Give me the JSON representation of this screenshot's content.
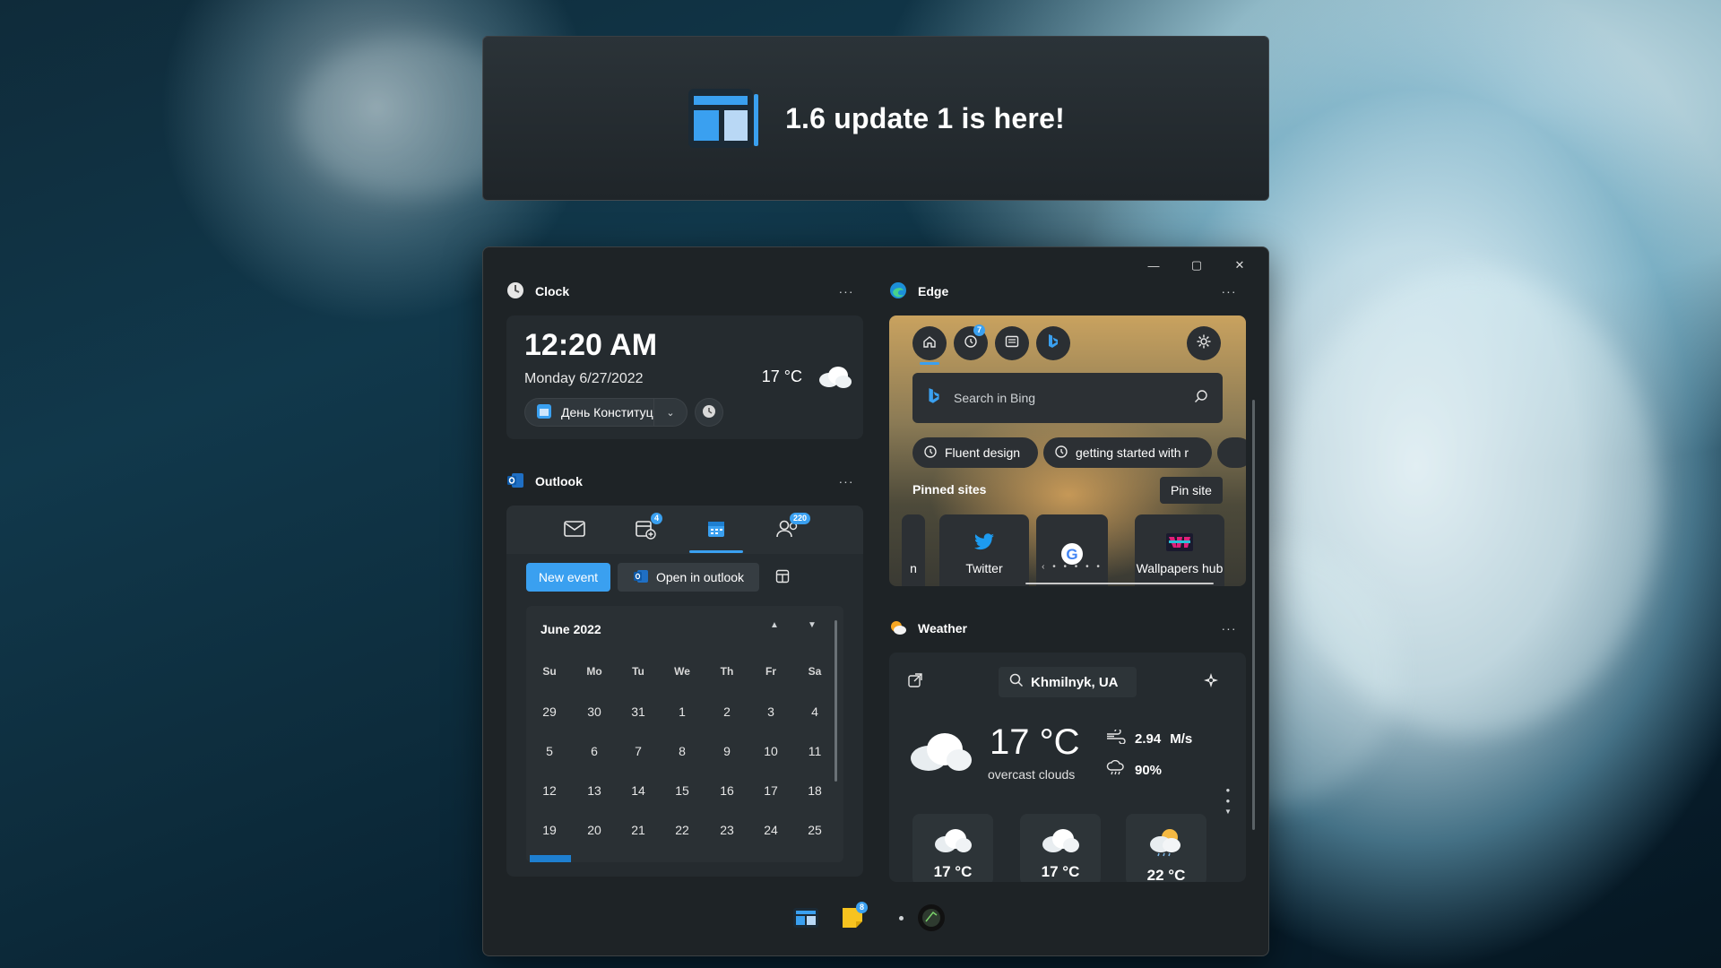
{
  "banner": {
    "title": "1.6 update 1 is here!"
  },
  "window_controls": {
    "minimize": "—",
    "maximize": "▢",
    "close": "✕"
  },
  "clock": {
    "header": "Clock",
    "time": "12:20 AM",
    "date": "Monday 6/27/2022",
    "temperature": "17 °C",
    "holiday": "День Конституц"
  },
  "outlook": {
    "header": "Outlook",
    "calendar_badge": "4",
    "people_badge": "220",
    "new_event": "New event",
    "open_in_outlook": "Open in outlook",
    "month": "June 2022",
    "days_of_week": [
      "Su",
      "Mo",
      "Tu",
      "We",
      "Th",
      "Fr",
      "Sa"
    ],
    "weeks": [
      [
        "29",
        "30",
        "31",
        "1",
        "2",
        "3",
        "4"
      ],
      [
        "5",
        "6",
        "7",
        "8",
        "9",
        "10",
        "11"
      ],
      [
        "12",
        "13",
        "14",
        "15",
        "16",
        "17",
        "18"
      ],
      [
        "19",
        "20",
        "21",
        "22",
        "23",
        "24",
        "25"
      ]
    ]
  },
  "edge": {
    "header": "Edge",
    "history_badge": "7",
    "search_placeholder": "Search in Bing",
    "chips": [
      "Fluent design",
      "getting started with r"
    ],
    "pinned_title": "Pinned sites",
    "pin_site": "Pin site",
    "sites": [
      {
        "label": "n"
      },
      {
        "label": "Twitter"
      },
      {
        "label": ""
      },
      {
        "label": "Wallpapers hub"
      }
    ]
  },
  "weather": {
    "header": "Weather",
    "location": "Khmilnyk, UA",
    "temperature": "17 °C",
    "condition": "overcast clouds",
    "wind": "2.94",
    "wind_unit": "M/s",
    "humidity": "90%",
    "forecast": [
      "17 °C",
      "17 °C",
      "22 °C"
    ]
  },
  "dock": {
    "notes_badge": "8"
  },
  "colors": {
    "accent": "#3aa0f0",
    "window_bg": "#1e2326",
    "card_bg": "#252b2f"
  }
}
